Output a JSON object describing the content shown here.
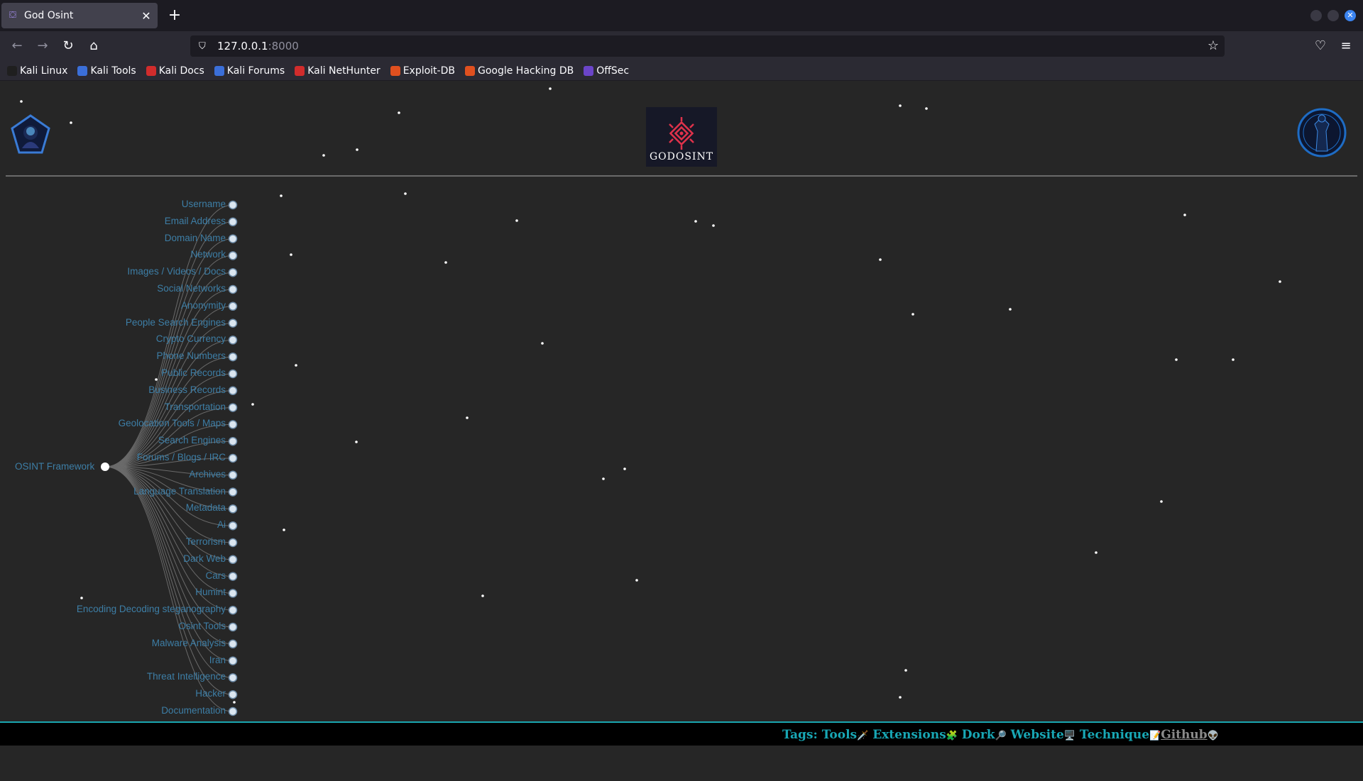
{
  "browser": {
    "tab_title": "God Osint",
    "url_host": "127.0.0.1",
    "url_port": ":8000",
    "bookmarks": [
      {
        "label": "Kali Linux",
        "color": "#1f1f1f"
      },
      {
        "label": "Kali Tools",
        "color": "#3b6fd9"
      },
      {
        "label": "Kali Docs",
        "color": "#d12c2c"
      },
      {
        "label": "Kali Forums",
        "color": "#3b6fd9"
      },
      {
        "label": "Kali NetHunter",
        "color": "#d12c2c"
      },
      {
        "label": "Exploit-DB",
        "color": "#e0501f"
      },
      {
        "label": "Google Hacking DB",
        "color": "#e0501f"
      },
      {
        "label": "OffSec",
        "color": "#6b45c9"
      }
    ]
  },
  "page": {
    "brand": "GODOSINT",
    "root": "OSINT Framework",
    "nodes": [
      "Username",
      "Email Address",
      "Domain Name",
      "Network",
      "Images / Videos / Docs",
      "Social Networks",
      "Anonymity",
      "People Search Engines",
      "Crypto Currency",
      "Phone Numbers",
      "Public Records",
      "Business Records",
      "Transportation",
      "Geolocation Tools / Maps",
      "Search Engines",
      "Forums / Blogs / IRC",
      "Archives",
      "Language Translation",
      "Metadata",
      "Ai",
      "Terrorism",
      "Dark Web",
      "Cars",
      "Humint",
      "Encoding Decoding steganography",
      "Osint Tools",
      "Malware Analysis",
      "Iran",
      "Threat Intelligence",
      "Hacker",
      "Documentation"
    ]
  },
  "footer": {
    "tags_label": "Tags:",
    "items": [
      {
        "text": "Tools",
        "emoji": "🗡️"
      },
      {
        "text": " Extensions",
        "emoji": "🧩"
      },
      {
        "text": " Dork",
        "emoji": "🔎"
      },
      {
        "text": " Website",
        "emoji": "🖥️"
      },
      {
        "text": " Technique",
        "emoji": "📝"
      }
    ],
    "github": "Github",
    "github_emoji": "👽"
  },
  "colors": {
    "link": "#3d7ea6",
    "accent": "#18a7b5",
    "background": "#262626"
  }
}
